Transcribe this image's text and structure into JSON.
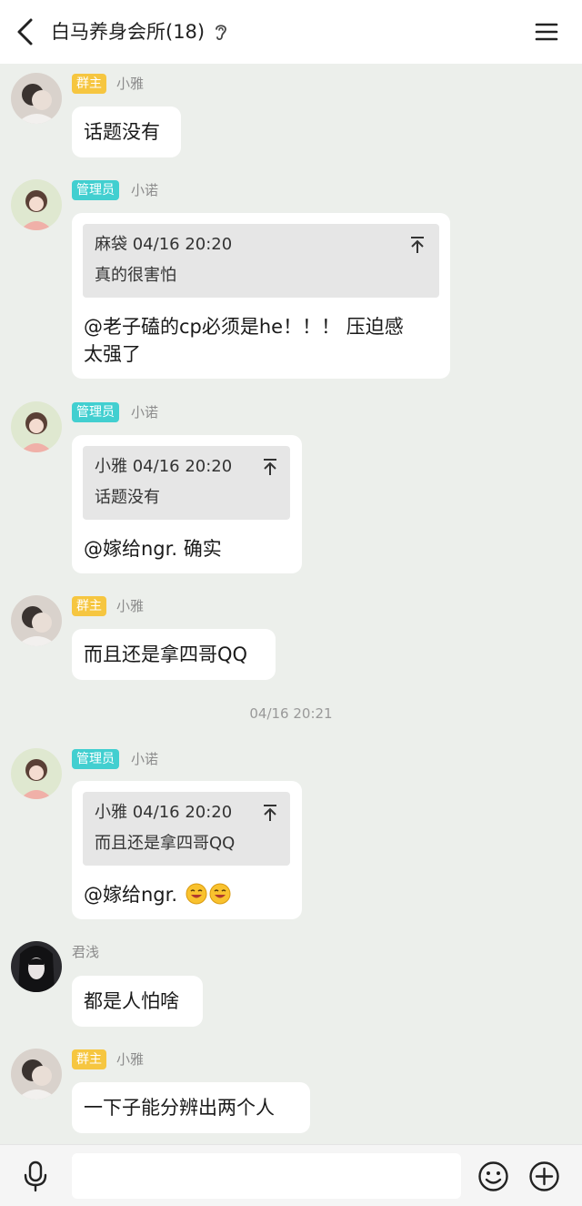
{
  "header": {
    "title": "白马养身会所(18)",
    "back_icon": "chevron-left-icon",
    "ear_icon": "ear-icon",
    "menu_icon": "menu-icon"
  },
  "colors": {
    "owner_badge": "#f6c640",
    "admin_badge": "#42cfd0",
    "chat_bg": "#ecefeb",
    "bubble_bg": "#ffffff",
    "quote_bg": "#e6e6e6"
  },
  "messages": [
    {
      "badge": "群主",
      "nick": "小雅",
      "text": "话题没有"
    },
    {
      "badge": "管理员",
      "nick": "小诺",
      "quote": {
        "head": "麻袋 04/16 20:20",
        "body": "真的很害怕"
      },
      "text_lines": [
        "@老子磕的cp必须是he！！！ 压迫感",
        "太强了"
      ]
    },
    {
      "badge": "管理员",
      "nick": "小诺",
      "quote": {
        "head": "小雅 04/16 20:20",
        "body": "话题没有"
      },
      "text": "@嫁给ngr. 确实"
    },
    {
      "badge": "群主",
      "nick": "小雅",
      "text": "而且还是拿四哥QQ"
    },
    {
      "badge": "管理员",
      "nick": "小诺",
      "quote": {
        "head": "小雅 04/16 20:20",
        "body": "而且还是拿四哥QQ"
      },
      "text": "@嫁给ngr.",
      "emojis": [
        "grin-emoji",
        "grin-emoji"
      ]
    },
    {
      "badge": "",
      "nick": "君浅",
      "text": "都是人怕啥"
    },
    {
      "badge": "群主",
      "nick": "小雅",
      "text": "一下子能分辨出两个人"
    }
  ],
  "timestamp": "04/16 20:21",
  "input": {
    "placeholder": ""
  },
  "bottom": {
    "mic_icon": "microphone-icon",
    "emoji_icon": "smiley-icon",
    "plus_icon": "plus-circle-icon"
  }
}
